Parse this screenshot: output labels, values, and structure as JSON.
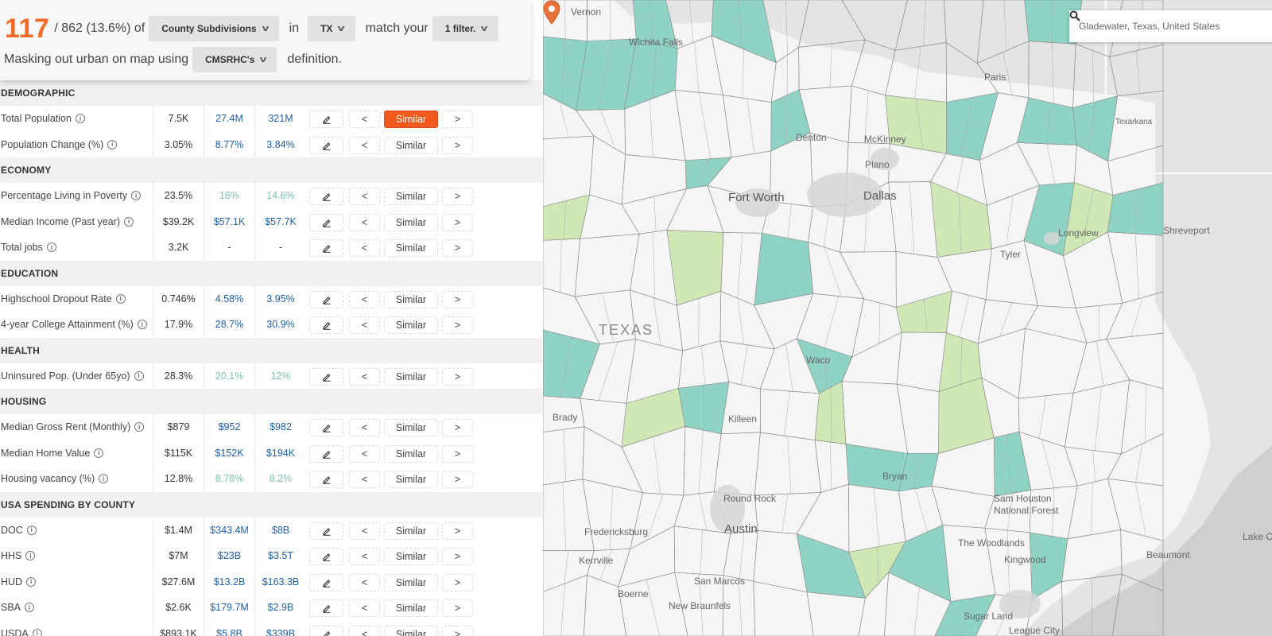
{
  "header": {
    "count": "117",
    "total_text": "/ 862 (13.6%) of",
    "geo_type": "County Subdivisions",
    "in_label": "in",
    "state": "TX",
    "match_label": "match your",
    "filter": "1 filter.",
    "masking_label": "Masking out urban on map using",
    "definition_select": "CMSRHC's",
    "definition_suffix": "definition."
  },
  "controls": {
    "prev": "<",
    "next": ">",
    "similar": "Similar",
    "info": "i"
  },
  "sections": [
    {
      "title": "DEMOGRAPHIC",
      "rows": [
        {
          "label": "Total Population",
          "local": "7.5K",
          "v2": "27.4M",
          "v3": "321M",
          "c2": "blue",
          "c3": "blue",
          "active": true
        },
        {
          "label": "Population Change (%)",
          "local": "3.05%",
          "v2": "8.77%",
          "v3": "3.84%",
          "c2": "blue",
          "c3": "blue"
        }
      ]
    },
    {
      "title": "ECONOMY",
      "rows": [
        {
          "label": "Percentage Living in Poverty",
          "local": "23.5%",
          "v2": "16%",
          "v3": "14.6%",
          "c2": "green",
          "c3": "green"
        },
        {
          "label": "Median Income (Past year)",
          "local": "$39.2K",
          "v2": "$57.1K",
          "v3": "$57.7K",
          "c2": "blue",
          "c3": "blue"
        },
        {
          "label": "Total jobs",
          "local": "3.2K",
          "v2": "-",
          "v3": "-",
          "c2": "loc",
          "c3": "loc"
        }
      ]
    },
    {
      "title": "EDUCATION",
      "rows": [
        {
          "label": "Highschool Dropout Rate",
          "local": "0.746%",
          "v2": "4.58%",
          "v3": "3.95%",
          "c2": "blue",
          "c3": "blue"
        },
        {
          "label": "4-year College Attainment (%)",
          "local": "17.9%",
          "v2": "28.7%",
          "v3": "30.9%",
          "c2": "blue",
          "c3": "blue"
        }
      ]
    },
    {
      "title": "HEALTH",
      "rows": [
        {
          "label": "Uninsured Pop. (Under 65yo)",
          "local": "28.3%",
          "v2": "20.1%",
          "v3": "12%",
          "c2": "green",
          "c3": "green"
        }
      ]
    },
    {
      "title": "HOUSING",
      "rows": [
        {
          "label": "Median Gross Rent (Monthly)",
          "local": "$879",
          "v2": "$952",
          "v3": "$982",
          "c2": "blue",
          "c3": "blue"
        },
        {
          "label": "Median Home Value",
          "local": "$115K",
          "v2": "$152K",
          "v3": "$194K",
          "c2": "blue",
          "c3": "blue"
        },
        {
          "label": "Housing vacancy (%)",
          "local": "12.8%",
          "v2": "8.78%",
          "v3": "8.2%",
          "c2": "green",
          "c3": "green"
        }
      ]
    },
    {
      "title": "USA SPENDING BY COUNTY",
      "rows": [
        {
          "label": "DOC",
          "local": "$1.4M",
          "v2": "$343.4M",
          "v3": "$8B",
          "c2": "blue",
          "c3": "blue"
        },
        {
          "label": "HHS",
          "local": "$7M",
          "v2": "$23B",
          "v3": "$3.5T",
          "c2": "blue",
          "c3": "blue"
        },
        {
          "label": "HUD",
          "local": "$27.6M",
          "v2": "$13.2B",
          "v3": "$163.3B",
          "c2": "blue",
          "c3": "blue"
        },
        {
          "label": "SBA",
          "local": "$2.6K",
          "v2": "$179.7M",
          "v3": "$2.9B",
          "c2": "blue",
          "c3": "blue"
        },
        {
          "label": "USDA",
          "local": "$893.1K",
          "v2": "$5.8B",
          "v3": "$339B",
          "c2": "blue",
          "c3": "blue"
        }
      ]
    }
  ],
  "map": {
    "search_placeholder": "Gladewater, Texas, United States",
    "labels": {
      "vernon": "Vernon",
      "wichita_falls": "Wichita Falls",
      "paris": "Paris",
      "texarkana": "Texarkana",
      "denton": "Denton",
      "mckinney": "McKinney",
      "plano": "Plano",
      "fort_worth": "Fort Worth",
      "dallas": "Dallas",
      "longview": "Longview",
      "tyler": "Tyler",
      "shreveport": "Shreveport",
      "texas": "TEXAS",
      "waco": "Waco",
      "brady": "Brady",
      "killeen": "Killeen",
      "bryan": "Bryan",
      "round_rock": "Round Rock",
      "sam_houston": "Sam Houston",
      "national_forest": "National Forest",
      "fredericksburg": "Fredericksburg",
      "austin": "Austin",
      "the_woodlands": "The Woodlands",
      "kingwood": "Kingwood",
      "beaumont": "Beaumont",
      "lake_c": "Lake C",
      "kerrville": "Kerrville",
      "san_marcos": "San Marcos",
      "boerne": "Boerne",
      "new_braunfels": "New Braunfels",
      "sugar_land": "Sugar Land",
      "league_city": "League City"
    },
    "colors": {
      "teal": "#8fd3c4",
      "light_green": "#cfe8b6",
      "orange_accent": "#f05a1c",
      "pin": "#e8743c"
    }
  }
}
